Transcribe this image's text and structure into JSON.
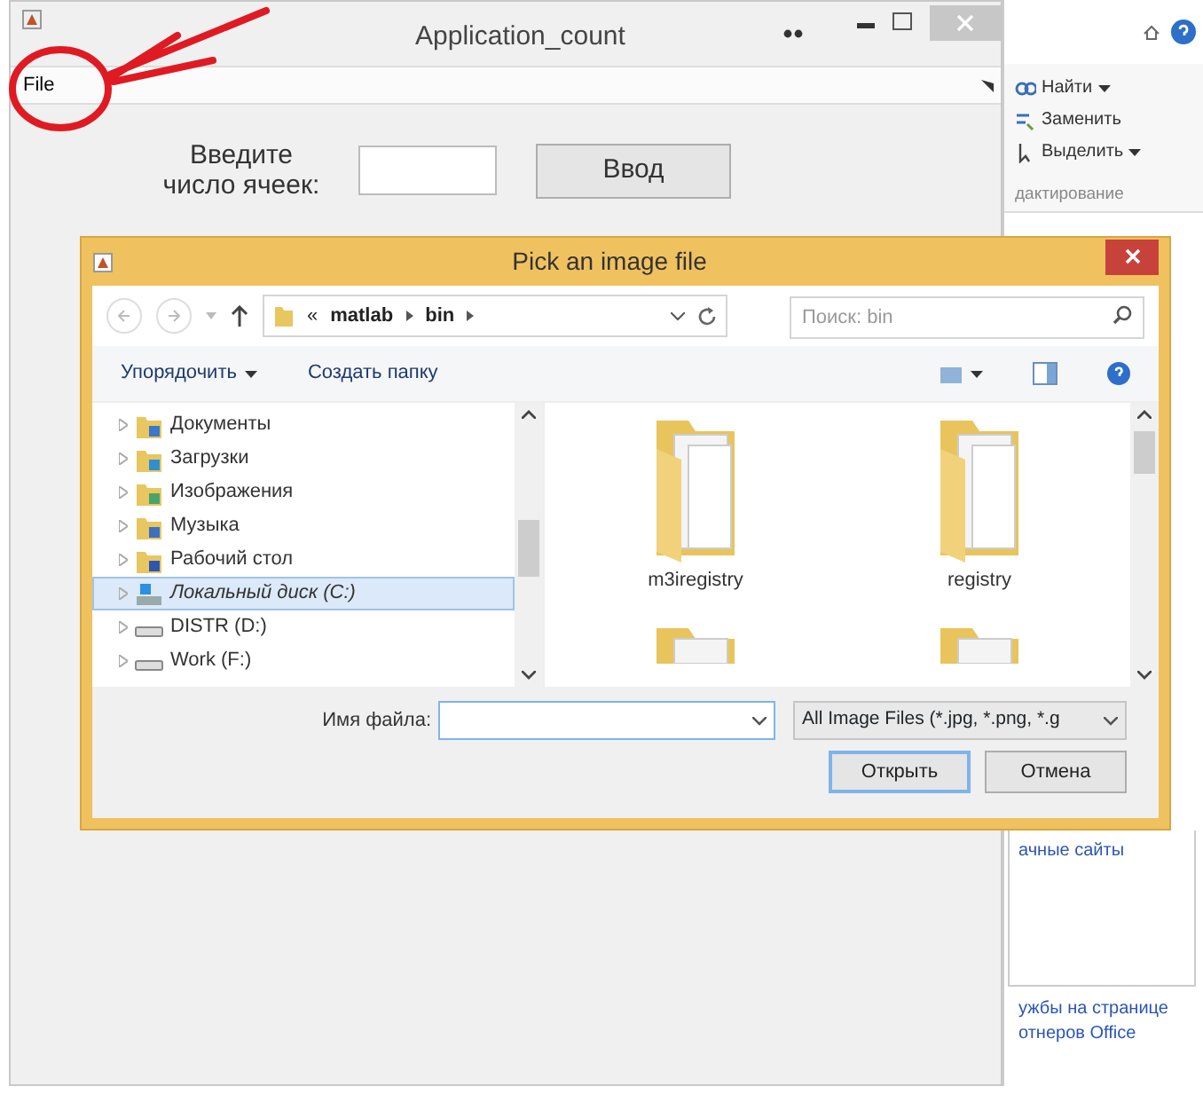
{
  "app_window": {
    "title": "Application_count",
    "menu": [
      {
        "label": "File"
      }
    ],
    "prompt": "Введите число ячеек:",
    "button": "Ввод"
  },
  "dialog": {
    "title": "Pick an image file",
    "overflow_mark": "«",
    "breadcrumb": [
      "matlab",
      "bin"
    ],
    "search": {
      "placeholder": "Поиск: bin"
    },
    "toolbar": [
      {
        "label": "Упорядочить",
        "dropdown": true
      },
      {
        "label": "Создать папку",
        "dropdown": false
      }
    ],
    "nav_items": [
      {
        "label": "Документы",
        "kind": "library",
        "selected": false
      },
      {
        "label": "Загрузки",
        "kind": "library",
        "selected": false
      },
      {
        "label": "Изображения",
        "kind": "library",
        "selected": false
      },
      {
        "label": "Музыка",
        "kind": "library",
        "selected": false
      },
      {
        "label": "Рабочий стол",
        "kind": "library",
        "selected": false
      },
      {
        "label": "Локальный диск (C:)",
        "kind": "system-drive",
        "selected": true
      },
      {
        "label": "DISTR (D:)",
        "kind": "drive",
        "selected": false
      },
      {
        "label": "Work (F:)",
        "kind": "drive",
        "selected": false
      }
    ],
    "files": [
      {
        "name": "m3iregistry"
      },
      {
        "name": "registry"
      }
    ],
    "file_name_label": "Имя файла:",
    "file_type": "All Image Files (*.jpg, *.png, *.g",
    "buttons": [
      {
        "label": "Открыть",
        "default": true
      },
      {
        "label": "Отмена",
        "default": false
      }
    ]
  },
  "background_window": {
    "ribbon": [
      {
        "label": "Найти",
        "dropdown": true
      },
      {
        "label": "Заменить",
        "dropdown": false
      },
      {
        "label": "Выделить",
        "dropdown": true
      }
    ],
    "group_label": "дактирование",
    "links": [
      "ачные сайты",
      "ужбы на странице",
      "отнеров Office"
    ]
  }
}
